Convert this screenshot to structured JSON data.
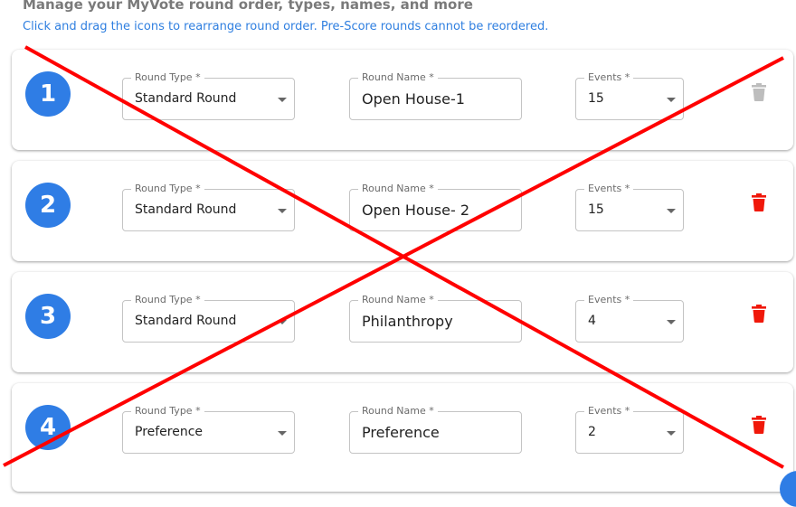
{
  "header": {
    "title": "Manage your MyVote round order, types, names, and more",
    "subtitle": "Click and drag the icons to rearrange round order. Pre-Score rounds cannot be reordered."
  },
  "labels": {
    "round_type": "Round Type *",
    "round_name": "Round Name *",
    "events": "Events *"
  },
  "rounds": [
    {
      "number": "1",
      "type": "Standard Round",
      "name": "Open House-1",
      "events": "15",
      "delete_enabled": false
    },
    {
      "number": "2",
      "type": "Standard Round",
      "name": "Open House- 2",
      "events": "15",
      "delete_enabled": true
    },
    {
      "number": "3",
      "type": "Standard Round",
      "name": "Philanthropy",
      "events": "4",
      "delete_enabled": true
    },
    {
      "number": "4",
      "type": "Preference",
      "name": "Preference",
      "events": "2",
      "delete_enabled": true
    }
  ],
  "colors": {
    "badge": "#2f7de5",
    "delete_active": "#f0180a",
    "delete_disabled": "#bdbdbd",
    "overlay_x": "#ff0000"
  },
  "icons": {
    "delete": "trash-icon",
    "dropdown": "chevron-down-icon"
  }
}
